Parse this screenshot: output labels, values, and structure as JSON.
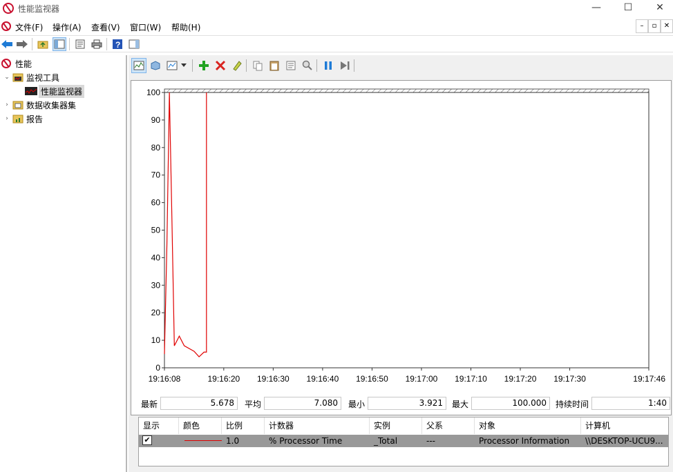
{
  "window": {
    "title": "性能监视器",
    "controls": {
      "minimize": "—",
      "maximize": "☐",
      "close": "✕"
    }
  },
  "menu": {
    "items": [
      "文件(F)",
      "操作(A)",
      "查看(V)",
      "窗口(W)",
      "帮助(H)"
    ],
    "mdi_controls": [
      "–",
      "▫",
      "✕"
    ]
  },
  "tree": {
    "root": "性能",
    "items": [
      {
        "label": "监视工具",
        "expanded": true
      },
      {
        "label": "性能监视器",
        "selected": true
      },
      {
        "label": "数据收集器集",
        "expanded": false
      },
      {
        "label": "报告",
        "expanded": false
      }
    ]
  },
  "chart_data": {
    "type": "line",
    "title": "",
    "xlabel": "",
    "ylabel": "",
    "ylim": [
      0,
      100
    ],
    "yticks": [
      "100",
      "90",
      "80",
      "70",
      "60",
      "50",
      "40",
      "30",
      "20",
      "10",
      "0"
    ],
    "xticks": [
      "19:16:08",
      "19:16:20",
      "19:16:30",
      "19:16:40",
      "19:16:50",
      "19:17:00",
      "19:17:10",
      "19:17:20",
      "19:17:30",
      "19:17:46"
    ],
    "grid": false,
    "series": [
      {
        "color": "#e00000",
        "x_seconds": [
          0,
          0.5,
          1,
          1.5,
          2,
          3,
          4,
          6,
          7,
          8,
          8.5,
          8.5
        ],
        "values": [
          5,
          45,
          100,
          55,
          8,
          11.5,
          8,
          6,
          4,
          5.7,
          5.7,
          100
        ]
      }
    ]
  },
  "stats": {
    "latest_label": "最新",
    "latest": "5.678",
    "average_label": "平均",
    "average": "7.080",
    "minimum_label": "最小",
    "minimum": "3.921",
    "maximum_label": "最大",
    "maximum": "100.000",
    "duration_label": "持续时间",
    "duration": "1:40"
  },
  "counters": {
    "columns": [
      "显示",
      "颜色",
      "比例",
      "计数器",
      "实例",
      "父系",
      "对象",
      "计算机"
    ],
    "rows": [
      {
        "show": "✔",
        "color": "#e00000",
        "scale": "1.0",
        "counter": "% Processor Time",
        "instance": "_Total",
        "parent": "---",
        "object": "Processor Information",
        "computer": "\\\\DESKTOP-UCU9..."
      }
    ]
  }
}
